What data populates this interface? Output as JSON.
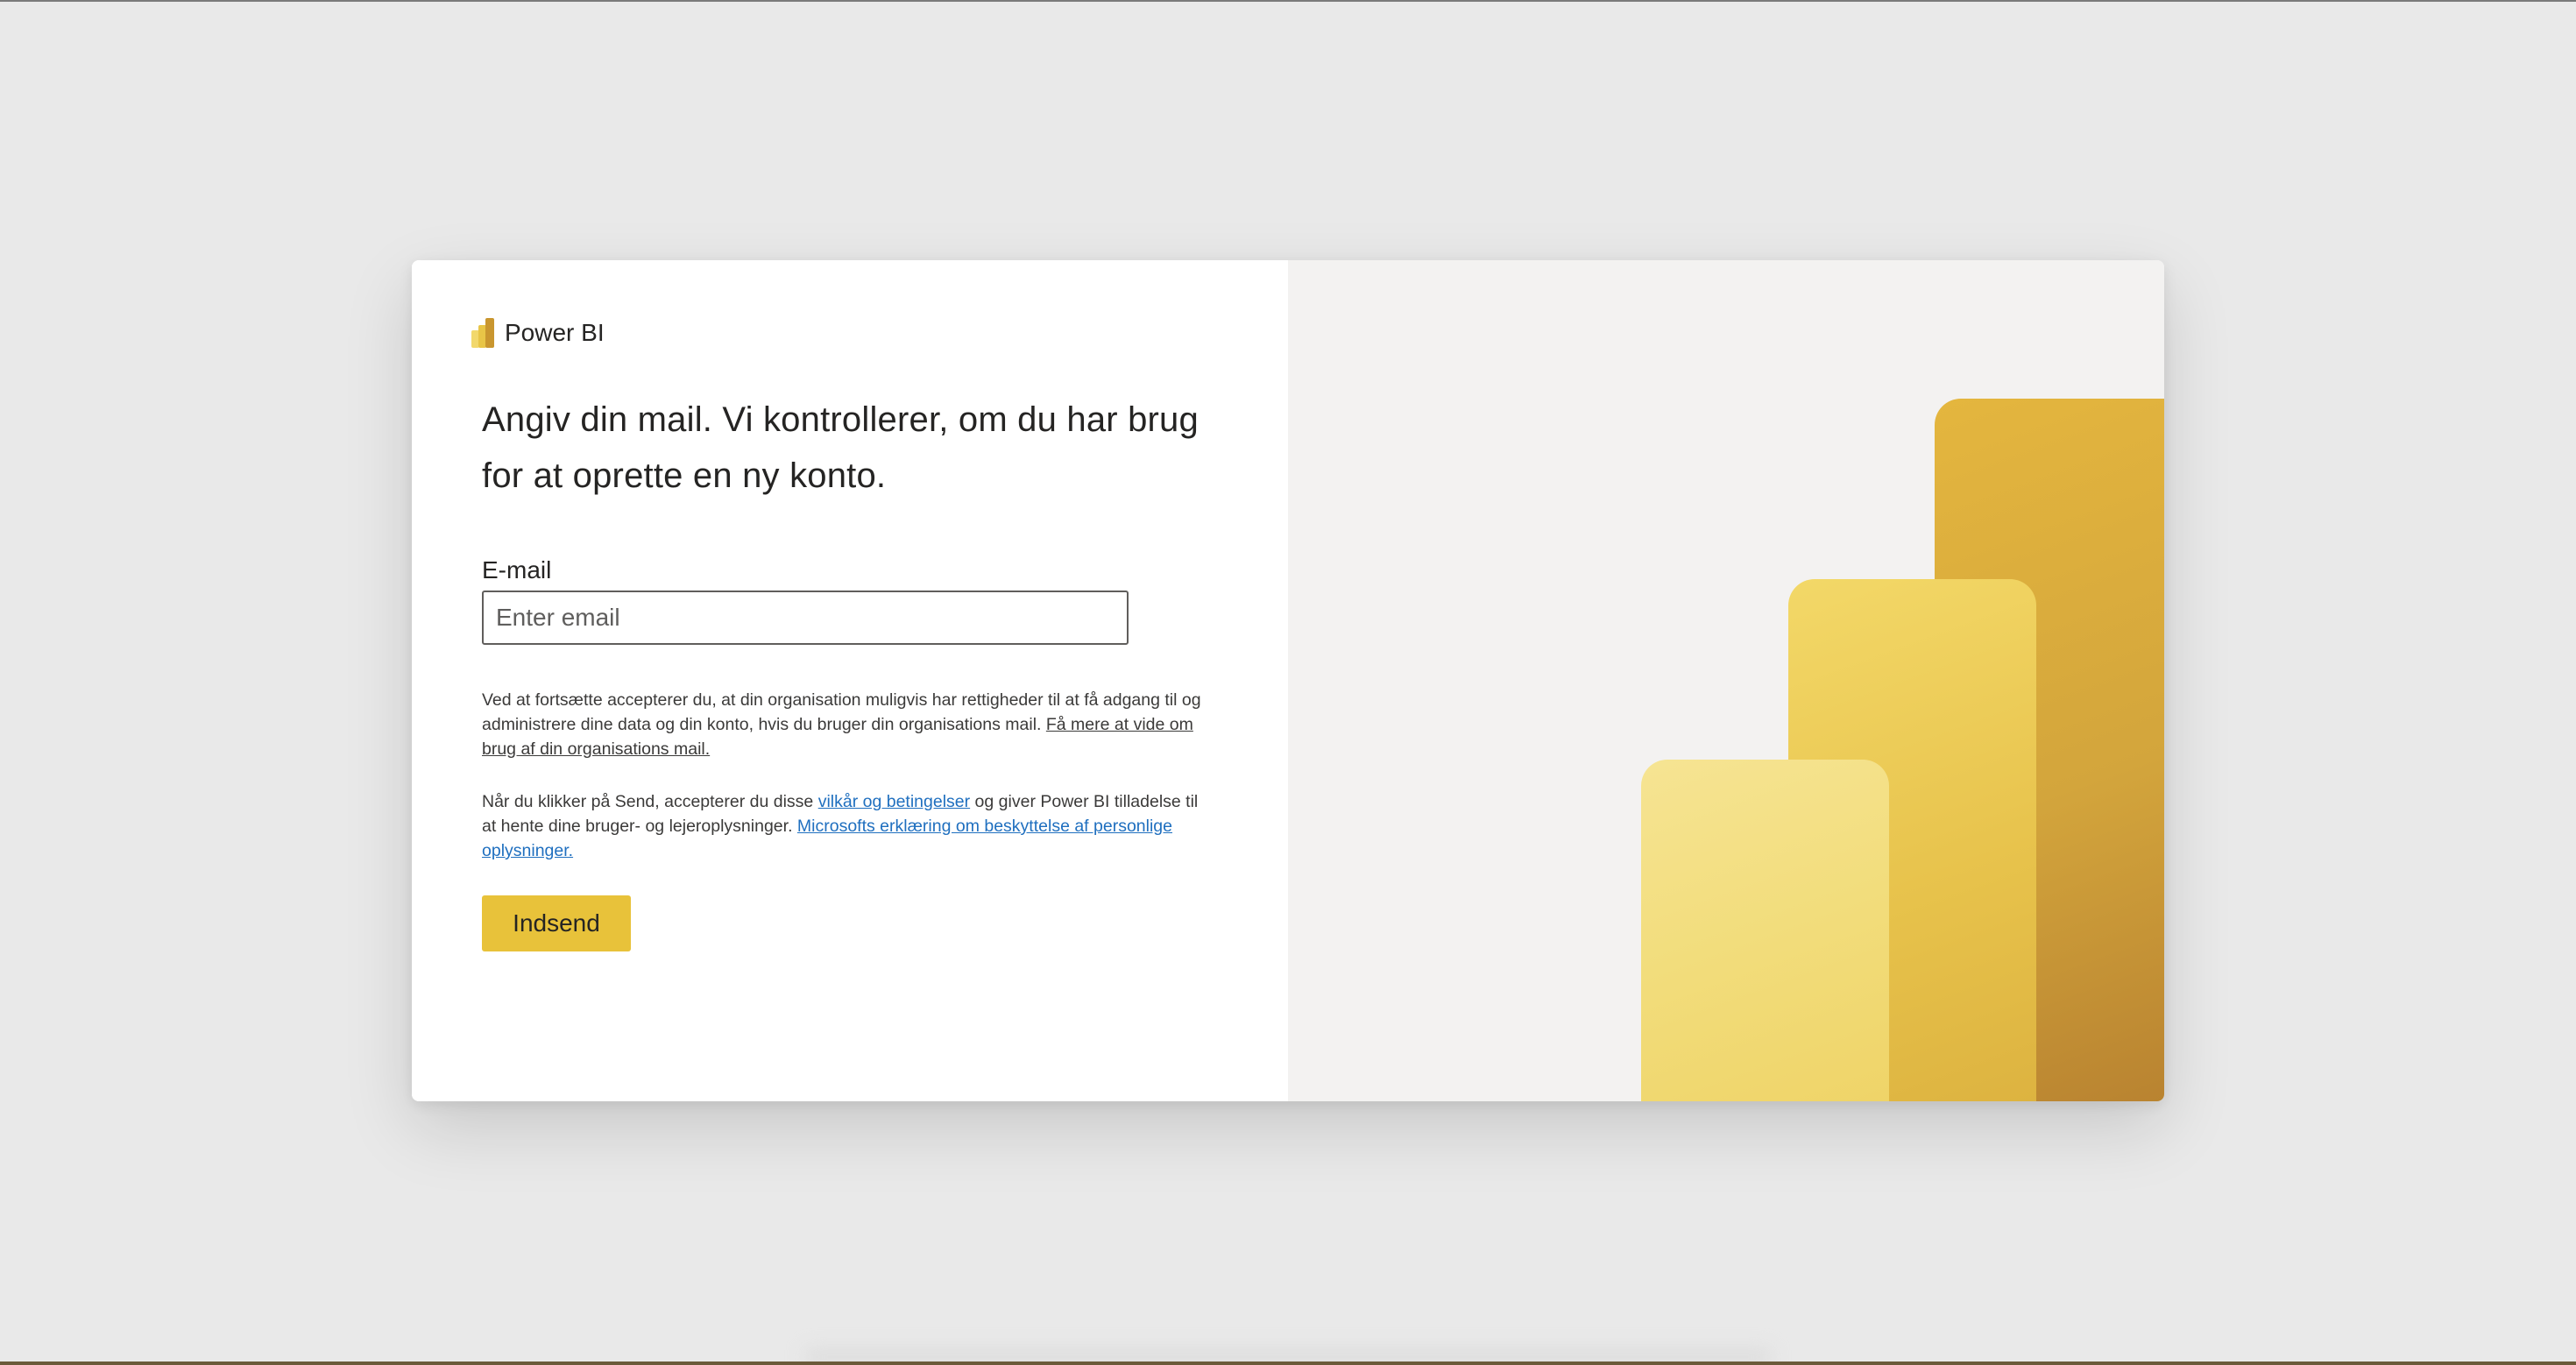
{
  "brand": {
    "name": "Power BI",
    "logo_icon": "power-bi-logo-icon"
  },
  "form": {
    "heading": "Angiv din mail. Vi kontrollerer, om du har brug for at oprette en ny konto.",
    "email_label": "E-mail",
    "email_placeholder": "Enter email",
    "email_value": "",
    "legal_1_text": "Ved at fortsætte accepterer du, at din organisation muligvis har rettigheder til at få adgang til og administrere dine data og din konto, hvis du bruger din organisations mail. ",
    "legal_1_link": "Få mere at vide om brug af din organisations mail.",
    "legal_2_text_a": "Når du klikker på Send, accepterer du disse ",
    "legal_2_link_terms": "vilkår og betingelser",
    "legal_2_text_b": " og giver Power BI tilladelse til at hente dine bruger- og lejeroplysninger. ",
    "legal_2_link_privacy": "Microsofts erklæring om beskyttelse af personlige oplysninger.",
    "submit_label": "Indsend"
  },
  "colors": {
    "page_background": "#e9e9e9",
    "submit_button": "#e8c23a",
    "link_blue": "#1f6fbf",
    "art_panel_background": "#f3f2f1",
    "bar_dark": "#d3a53c",
    "bar_mid": "#e7c24b",
    "bar_light": "#f2dd7c"
  }
}
